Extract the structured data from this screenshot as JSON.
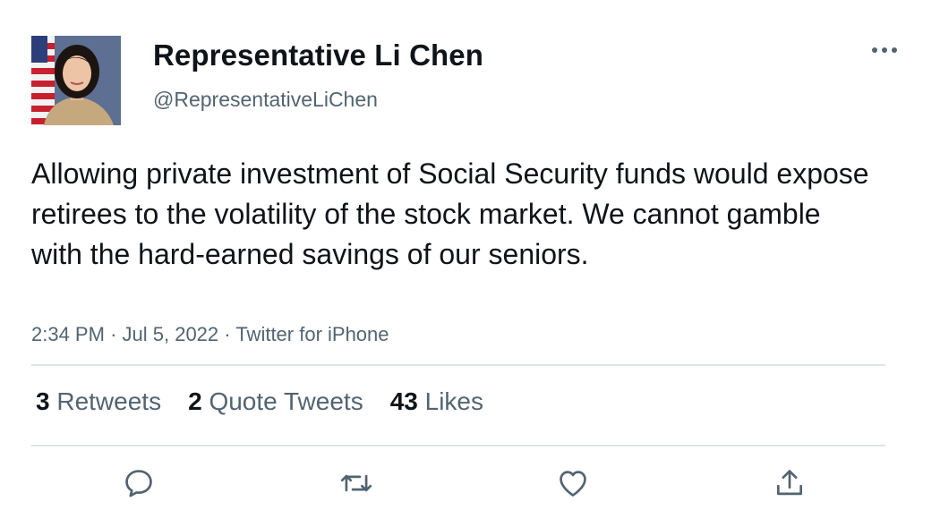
{
  "author": {
    "display_name": "Representative Li Chen",
    "handle": "@RepresentativeLiChen"
  },
  "tweet": {
    "text": "Allowing private investment of Social Security funds would expose retirees to the volatility of the stock market. We cannot gamble with the hard-earned savings of our seniors.",
    "time": "2:34 PM",
    "date": "Jul 5, 2022",
    "source": "Twitter for iPhone"
  },
  "separator": "·",
  "stats": {
    "retweets": {
      "count": "3",
      "label": "Retweets"
    },
    "quote_tweets": {
      "count": "2",
      "label": "Quote Tweets"
    },
    "likes": {
      "count": "43",
      "label": "Likes"
    }
  },
  "actions": {
    "reply_icon": "reply-icon",
    "retweet_icon": "retweet-icon",
    "like_icon": "heart-icon",
    "share_icon": "share-icon"
  },
  "colors": {
    "text": "#0f1419",
    "secondary": "#536471",
    "divider": "#e1e4e8"
  }
}
